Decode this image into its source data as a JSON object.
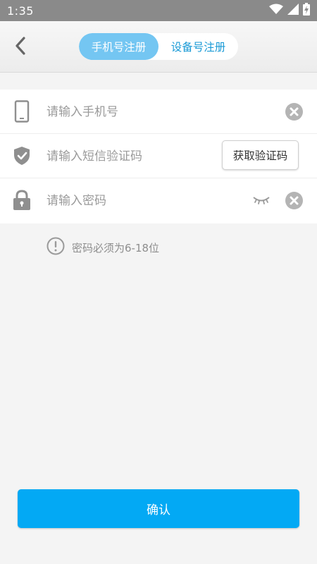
{
  "status_bar": {
    "time": "1:35",
    "icons": [
      "wifi-icon",
      "cellular-signal-icon",
      "battery-charging-icon"
    ]
  },
  "header": {
    "back_icon": "back-arrow-icon",
    "tabs": [
      {
        "label": "手机号注册",
        "active": true
      },
      {
        "label": "设备号注册",
        "active": false
      }
    ]
  },
  "form": {
    "phone": {
      "placeholder": "请输入手机号",
      "value": "",
      "icon": "phone-icon"
    },
    "sms_code": {
      "placeholder": "请输入短信验证码",
      "value": "",
      "icon": "shield-check-icon",
      "button_label": "获取验证码"
    },
    "password": {
      "placeholder": "请输入密码",
      "value": "",
      "icon": "lock-icon"
    }
  },
  "hint": {
    "icon": "exclamation-circle-icon",
    "text": "密码必须为6-18位"
  },
  "confirm_button": {
    "label": "确认"
  },
  "colors": {
    "accent": "#03a9f4",
    "tab_active": "#74c6f2",
    "tab_inactive_text": "#1a9ad6",
    "status_bar": "#8a8a8a"
  }
}
